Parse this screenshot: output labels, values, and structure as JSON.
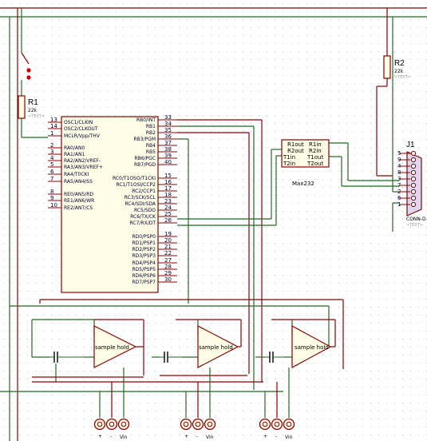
{
  "mcu": {
    "left_pins": [
      {
        "num": "13",
        "name": "OSC1/CLKIN"
      },
      {
        "num": "14",
        "name": "OSC2/CLKOUT"
      },
      {
        "num": "1",
        "name": "MCLR/Vpp/THV"
      },
      {
        "num": "2",
        "name": "RA0/AN0"
      },
      {
        "num": "3",
        "name": "RA1/AN1"
      },
      {
        "num": "4",
        "name": "RA2/AN2/VREF-"
      },
      {
        "num": "5",
        "name": "RA3/AN3/VREF+"
      },
      {
        "num": "6",
        "name": "RA4/T0CKI"
      },
      {
        "num": "7",
        "name": "RA5/AN4/SS"
      },
      {
        "num": "8",
        "name": "RE0/AN5/RD"
      },
      {
        "num": "9",
        "name": "RE1/AN6/WR"
      },
      {
        "num": "10",
        "name": "RE2/AN7/CS"
      }
    ],
    "right_pins": [
      {
        "num": "33",
        "name": "RB0/INT"
      },
      {
        "num": "34",
        "name": "RB1"
      },
      {
        "num": "35",
        "name": "RB2"
      },
      {
        "num": "36",
        "name": "RB3/PGM"
      },
      {
        "num": "37",
        "name": "RB4"
      },
      {
        "num": "38",
        "name": "RB5"
      },
      {
        "num": "39",
        "name": "RB6/PGC"
      },
      {
        "num": "40",
        "name": "RB7/PGD"
      },
      {
        "num": "15",
        "name": "RC0/T1OSO/T1CKI"
      },
      {
        "num": "16",
        "name": "RC1/T1OSI/CCP2"
      },
      {
        "num": "17",
        "name": "RC2/CCP1"
      },
      {
        "num": "18",
        "name": "RC3/SCK/SCL"
      },
      {
        "num": "23",
        "name": "RC4/SDI/SDA"
      },
      {
        "num": "24",
        "name": "RC5/SDO"
      },
      {
        "num": "25",
        "name": "RC6/TX/CK"
      },
      {
        "num": "26",
        "name": "RC7/RX/DT"
      },
      {
        "num": "19",
        "name": "RD0/PSP0"
      },
      {
        "num": "20",
        "name": "RD1/PSP1"
      },
      {
        "num": "21",
        "name": "RD2/PSP2"
      },
      {
        "num": "22",
        "name": "RD3/PSP3"
      },
      {
        "num": "27",
        "name": "RD4/PSP4"
      },
      {
        "num": "28",
        "name": "RD5/PSP5"
      },
      {
        "num": "29",
        "name": "RD6/PSP6"
      },
      {
        "num": "30",
        "name": "RD7/PSP7"
      }
    ]
  },
  "r1": {
    "ref": "R1",
    "value": "22k",
    "text": "<TEXT>"
  },
  "r2": {
    "ref": "R2",
    "value": "22k",
    "text": "<TEXT>"
  },
  "max232": {
    "name": "Max232",
    "in_left": [
      "R1out",
      "R2out",
      "T1in",
      "T2in"
    ],
    "in_right": [
      "R1in",
      "R2in",
      "T1out",
      "T2out"
    ]
  },
  "conn": {
    "ref": "J1",
    "pins": [
      "5",
      "9",
      "4",
      "8",
      "3",
      "7",
      "2",
      "6",
      "1"
    ],
    "name": "CONN-D",
    "text": "<TEXT>"
  },
  "sample_hold_label": "sample hold",
  "terminals": {
    "plus": "+",
    "minus": "-",
    "vin": "Vin"
  },
  "colors": {
    "wire": "#1f6b1f",
    "wire_red": "#8b0000",
    "component": "#8b0000",
    "body_fill": "#fffde6",
    "connector_fill": "#d8d8f0",
    "grid_dot": "#bdbdbd",
    "junction": "#cc0000"
  },
  "icons": {
    "switch": "push-button-switch-icon",
    "capacitor": "capacitor-icon",
    "opamp": "triangle-amplifier-icon",
    "terminal": "circle-terminal-icon",
    "connector": "db9-connector-icon"
  }
}
